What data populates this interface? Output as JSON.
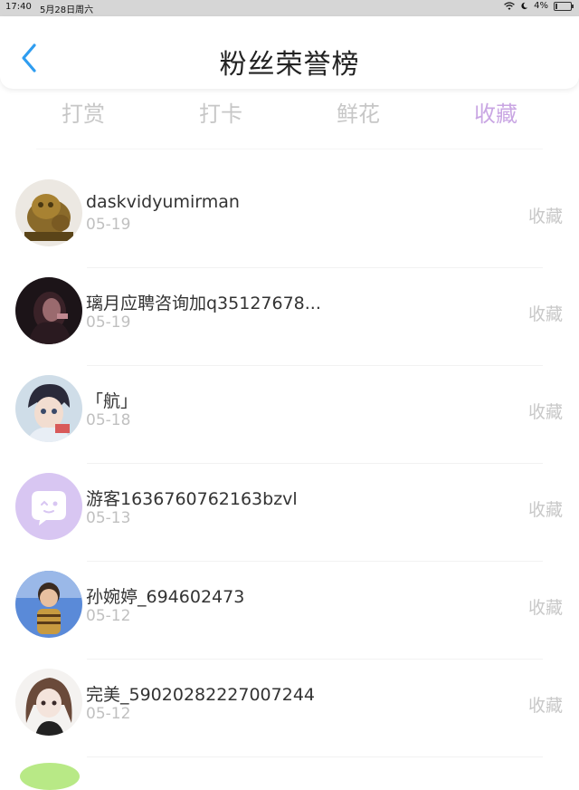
{
  "status_bar": {
    "time": "17:40",
    "date": "5月28日周六",
    "battery_percent": "4%"
  },
  "header": {
    "title": "粉丝荣誉榜"
  },
  "tabs": [
    {
      "label": "打赏",
      "active": false
    },
    {
      "label": "打卡",
      "active": false
    },
    {
      "label": "鲜花",
      "active": false
    },
    {
      "label": "收藏",
      "active": true
    }
  ],
  "colors": {
    "accent_active_tab": "#c9a6e3",
    "back_arrow": "#2f9df0",
    "inactive_text": "#c7c7c7"
  },
  "list": [
    {
      "name": "daskvidyumirman",
      "date": "05-19",
      "action": "收藏",
      "avatar": "lion-figurine-avatar"
    },
    {
      "name": "璃月应聘咨询加q35127678...",
      "date": "05-19",
      "action": "收藏",
      "avatar": "dark-photo-avatar"
    },
    {
      "name": "「航」",
      "date": "05-18",
      "action": "收藏",
      "avatar": "anime-character-avatar"
    },
    {
      "name": "游客1636760762163bzvl",
      "date": "05-13",
      "action": "收藏",
      "avatar": "default-chat-bubble-avatar"
    },
    {
      "name": "孙婉婷_694602473",
      "date": "05-12",
      "action": "收藏",
      "avatar": "child-photo-avatar"
    },
    {
      "name": "完美_59020282227007244",
      "date": "05-12",
      "action": "收藏",
      "avatar": "anime-girl-avatar"
    }
  ]
}
